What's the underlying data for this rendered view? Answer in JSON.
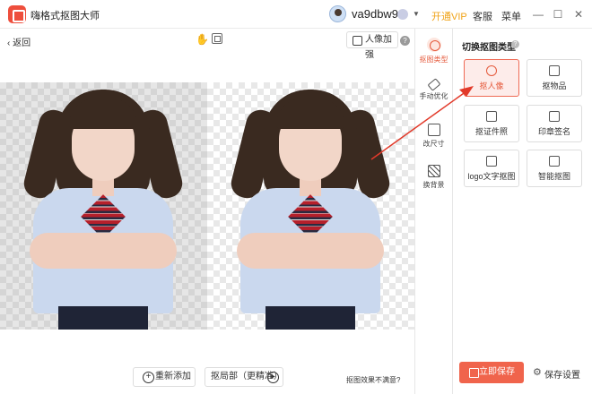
{
  "app": {
    "title": "嗨格式抠图大师",
    "username": "va9dbw9",
    "vip_link": "开通VIP",
    "service_link": "客服",
    "menu_link": "菜单"
  },
  "toolbar": {
    "back_label": "返回",
    "enhance_label": "人像加强",
    "help": "?"
  },
  "rail": [
    {
      "label": "抠图类型",
      "icon": "cutout-icon",
      "active": true
    },
    {
      "label": "手动优化",
      "icon": "eraser-icon",
      "active": false
    },
    {
      "label": "改尺寸",
      "icon": "resize-icon",
      "active": false
    },
    {
      "label": "换背景",
      "icon": "background-icon",
      "active": false
    }
  ],
  "panel": {
    "title": "切换抠图类型",
    "help": "?",
    "types": [
      {
        "label": "抠人像",
        "icon": "person-icon",
        "active": true
      },
      {
        "label": "抠物品",
        "icon": "box-icon",
        "active": false
      },
      {
        "label": "抠证件照",
        "icon": "id-card-icon",
        "active": false
      },
      {
        "label": "印章签名",
        "icon": "stamp-icon",
        "active": false
      },
      {
        "label": "logo文字抠图",
        "icon": "logo-icon",
        "active": false
      },
      {
        "label": "智能抠图",
        "icon": "smart-icon",
        "active": false
      }
    ]
  },
  "bottom": {
    "readd_label": "重新添加",
    "local_label": "抠局部（更精准）",
    "unsatisfied_label": "抠图效果不满意?"
  },
  "save": {
    "save_label": "立即保存",
    "settings_label": "保存设置"
  },
  "colors": {
    "accent": "#e55a3c",
    "vip": "#f0a318"
  }
}
